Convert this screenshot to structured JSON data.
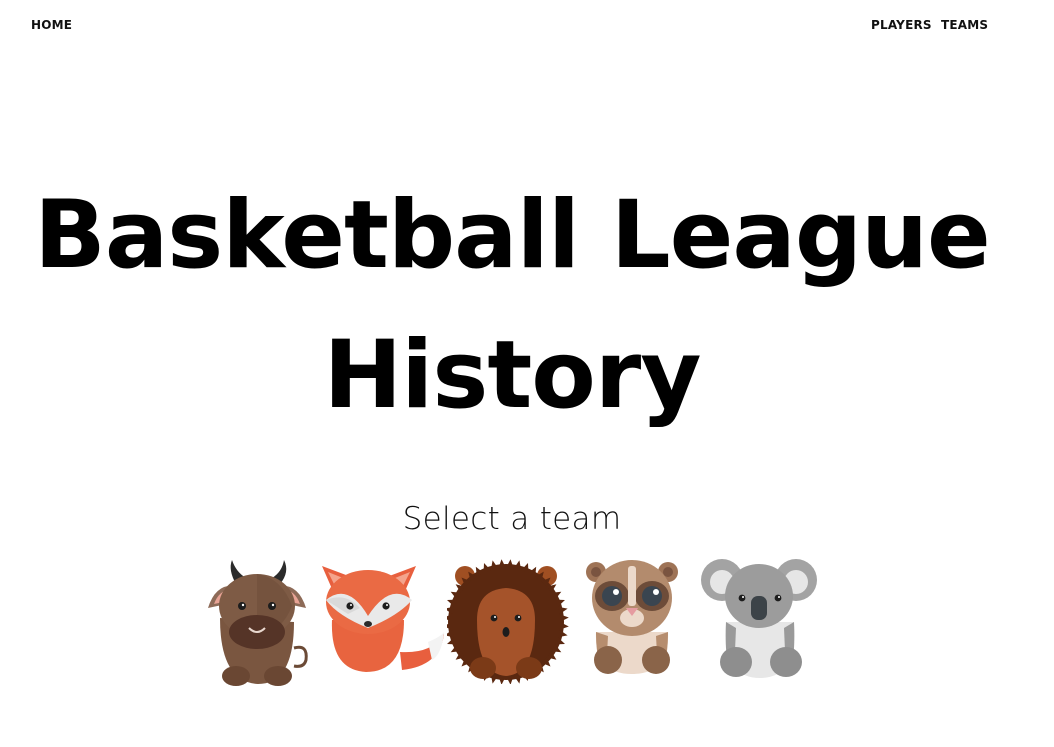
{
  "nav": {
    "home_label": "HOME",
    "players_label": "PLAYERS",
    "teams_label": "TEAMS"
  },
  "hero": {
    "title_line1": "Basketball League",
    "title_line2": "History"
  },
  "team_picker": {
    "prompt": "Select a team",
    "teams": [
      {
        "icon": "bull-icon"
      },
      {
        "icon": "fox-icon"
      },
      {
        "icon": "hedgehog-icon"
      },
      {
        "icon": "lemur-icon"
      },
      {
        "icon": "koala-icon"
      }
    ]
  }
}
